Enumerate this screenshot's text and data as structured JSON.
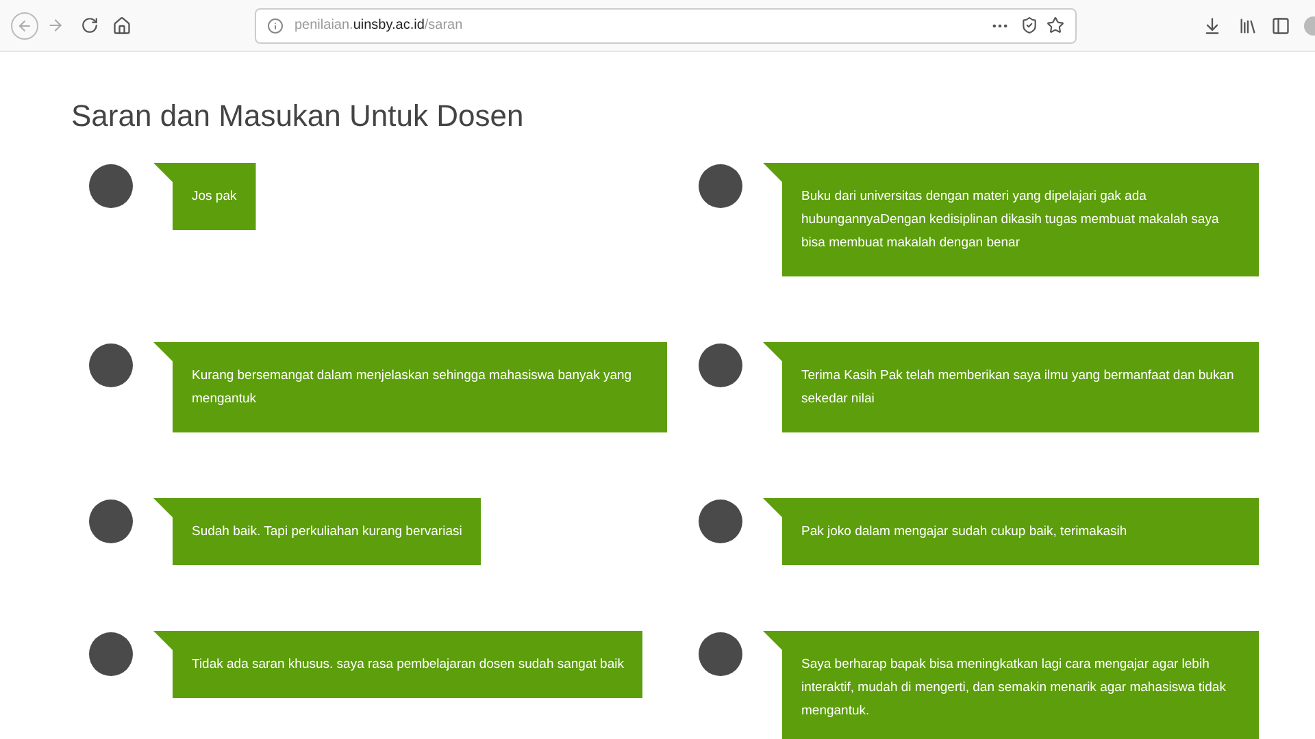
{
  "browser": {
    "url_prefix": "penilaian.",
    "url_domain": "uinsby.ac.id",
    "url_path": "/saran"
  },
  "page_title": "Saran dan Masukan Untuk Dosen",
  "comments": [
    {
      "text": "Jos pak"
    },
    {
      "text": "Buku dari universitas dengan materi yang dipelajari gak ada hubungannyaDengan kedisiplinan dikasih tugas membuat makalah saya bisa membuat makalah dengan benar"
    },
    {
      "text": "Kurang bersemangat dalam menjelaskan sehingga mahasiswa banyak yang mengantuk"
    },
    {
      "text": "Terima Kasih Pak telah memberikan saya ilmu yang bermanfaat dan bukan sekedar nilai"
    },
    {
      "text": "Sudah baik. Tapi perkuliahan kurang bervariasi"
    },
    {
      "text": "Pak joko dalam mengajar sudah cukup baik, terimakasih"
    },
    {
      "text": "Tidak ada saran khusus. saya rasa pembelajaran dosen sudah sangat baik"
    },
    {
      "text": "Saya berharap bapak bisa meningkatkan lagi cara mengajar agar lebih interaktif, mudah di mengerti, dan semakin menarik agar mahasiswa tidak mengantuk."
    }
  ]
}
